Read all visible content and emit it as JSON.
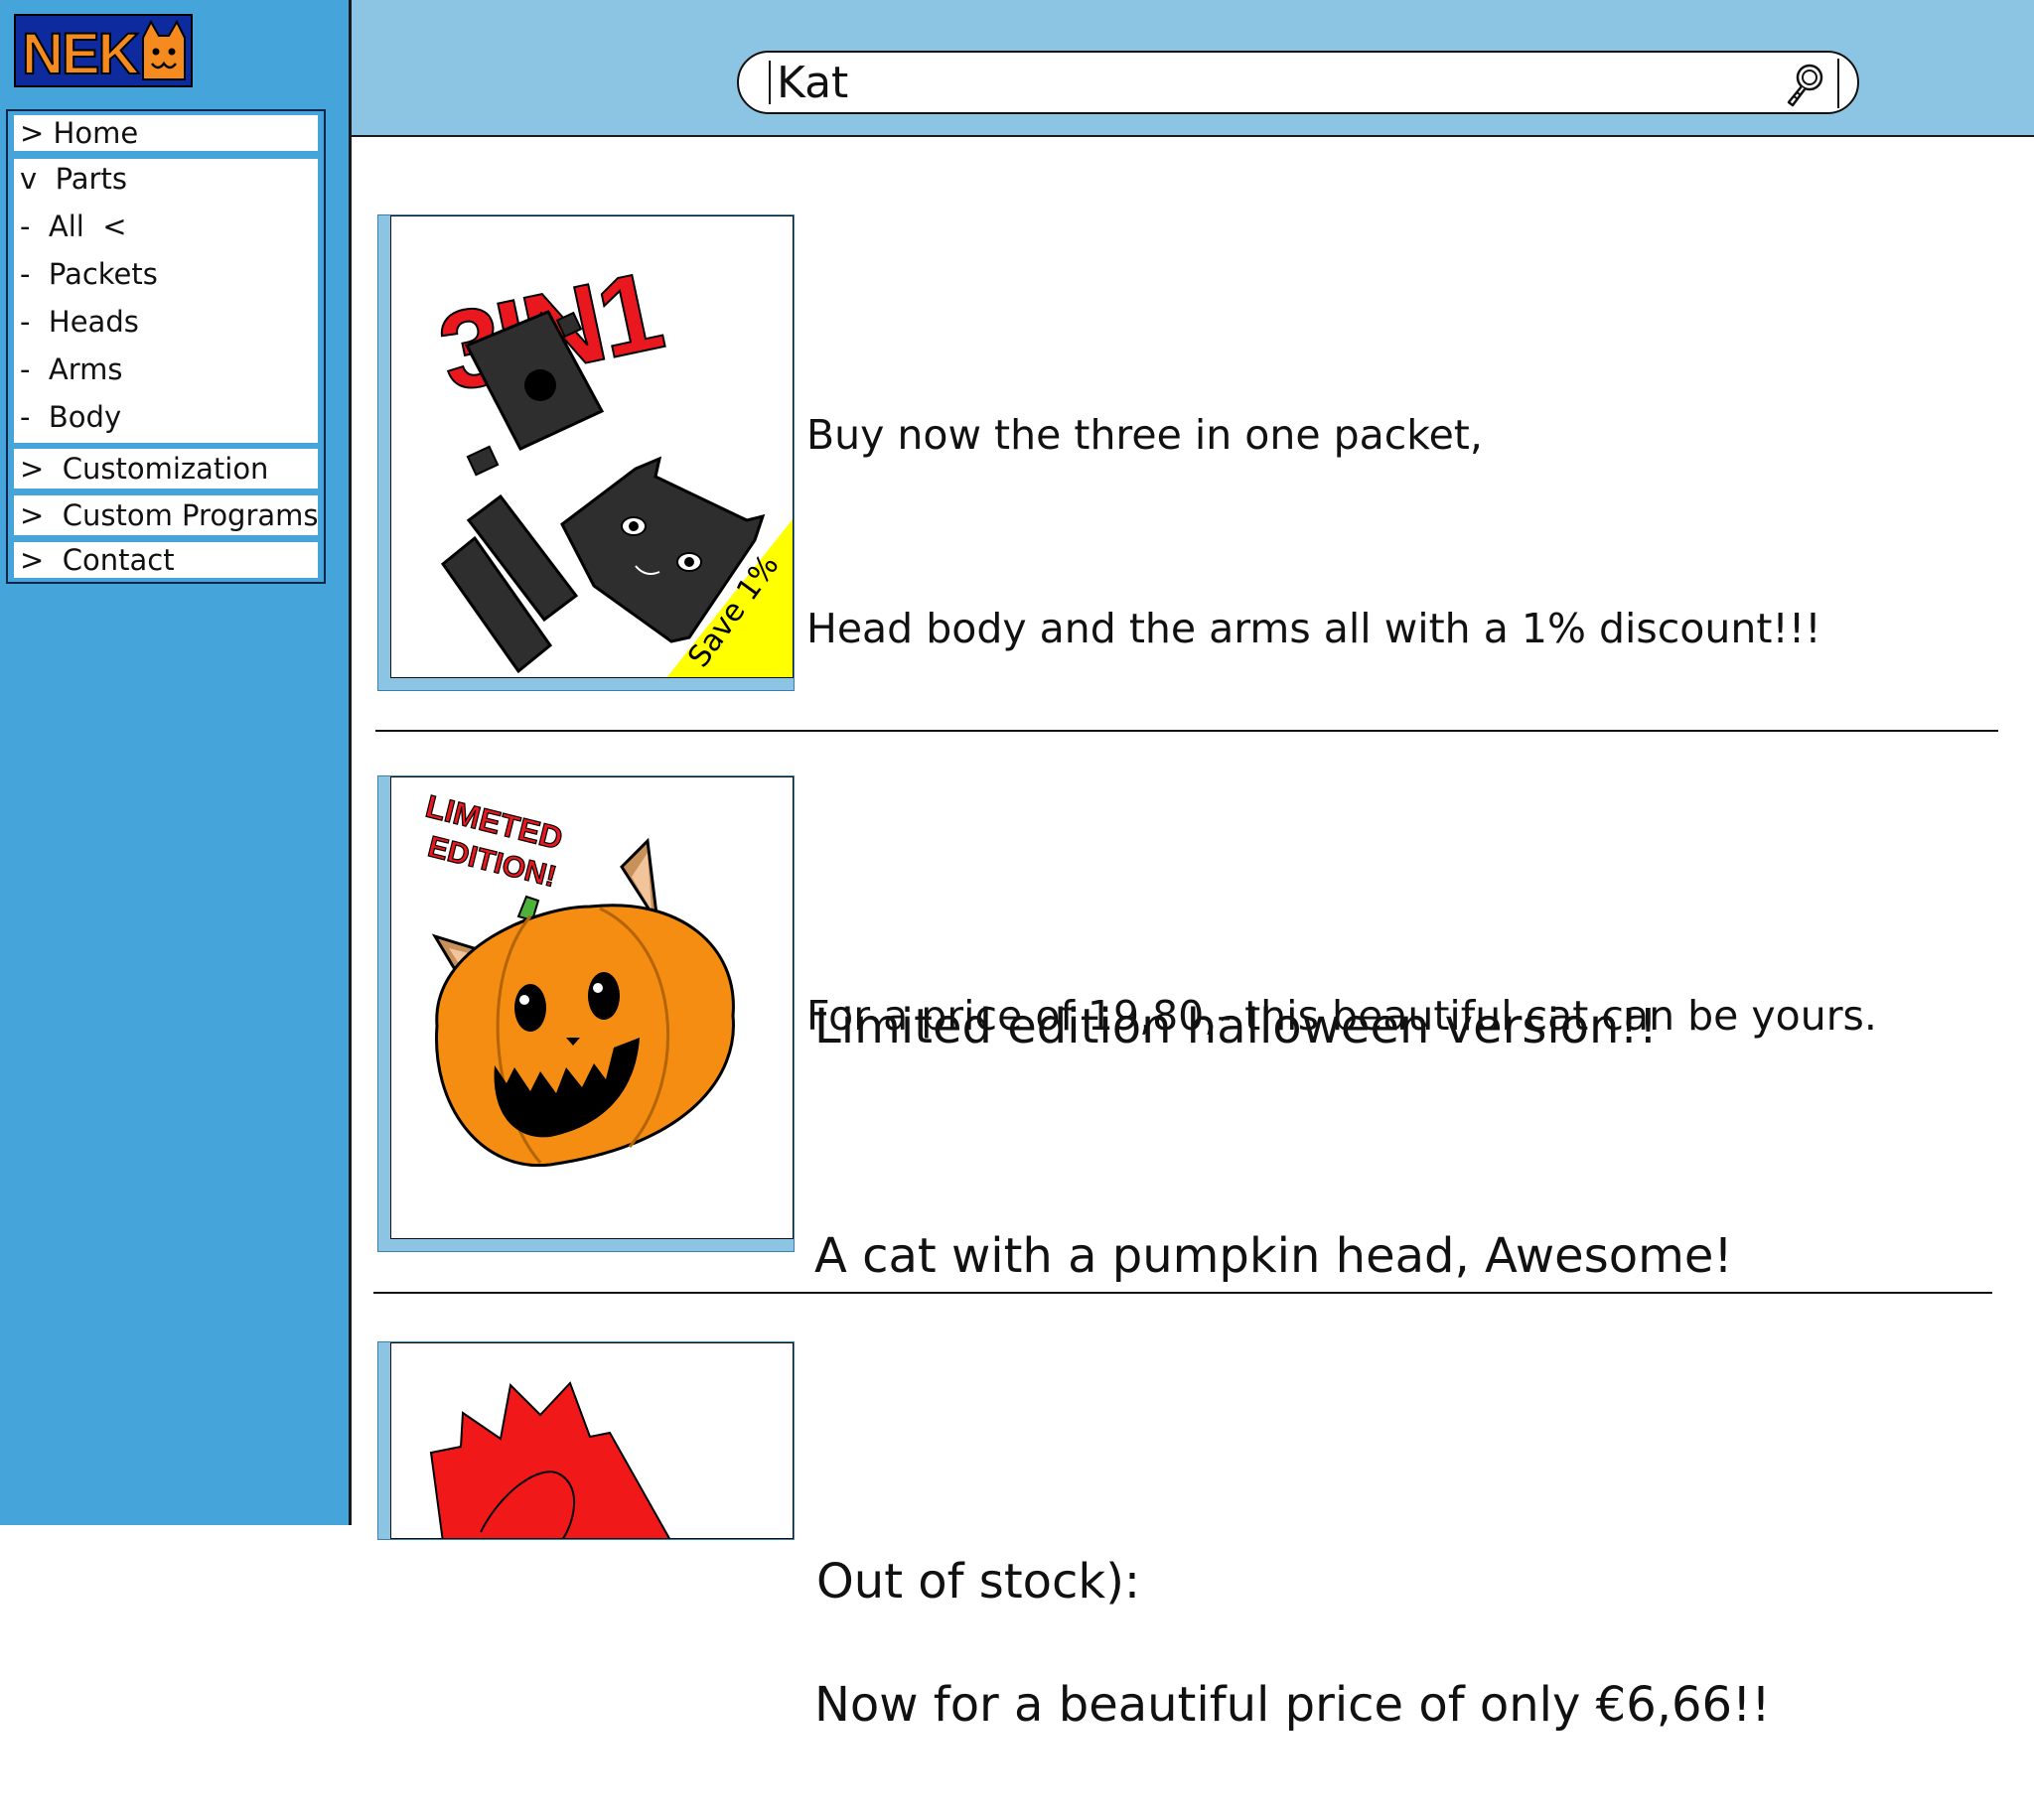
{
  "brand": {
    "logo_text": "NEK"
  },
  "search": {
    "value": "Kat"
  },
  "nav": {
    "home": "> Home",
    "parts": "v  Parts",
    "parts_sub": [
      {
        "label": "-  All  <"
      },
      {
        "label": "-  Packets"
      },
      {
        "label": "-  Heads"
      },
      {
        "label": "-  Arms"
      },
      {
        "label": "-  Body"
      }
    ],
    "customization": ">  Customization",
    "custom_programs": ">  Custom Programs",
    "contact": ">  Contact"
  },
  "products": [
    {
      "lines": [
        "Buy now the three in one packet,",
        "Head body and the arms all with a 1% discount!!!",
        "",
        "For a price of 19,80,- this beautiful cat can be yours."
      ],
      "image_title": "3IN1",
      "badge": "Save 1%"
    },
    {
      "lines": [
        "Limited edition halloween version!!",
        "A cat with a pumpkin head, Awesome!",
        "",
        "Now for a beautiful price of only €6,66!!"
      ],
      "image_banner_top": "LIMETED",
      "image_banner_bottom": "EDITION!"
    },
    {
      "lines": [
        "Out of stock):"
      ]
    }
  ],
  "colors": {
    "sidebar": "#45a4da",
    "header": "#8cc4e4",
    "logo_orange": "#f58a1f",
    "logo_bg": "#0d2a9e",
    "badge_yellow": "#ffff00",
    "title_red": "#e8181e"
  }
}
